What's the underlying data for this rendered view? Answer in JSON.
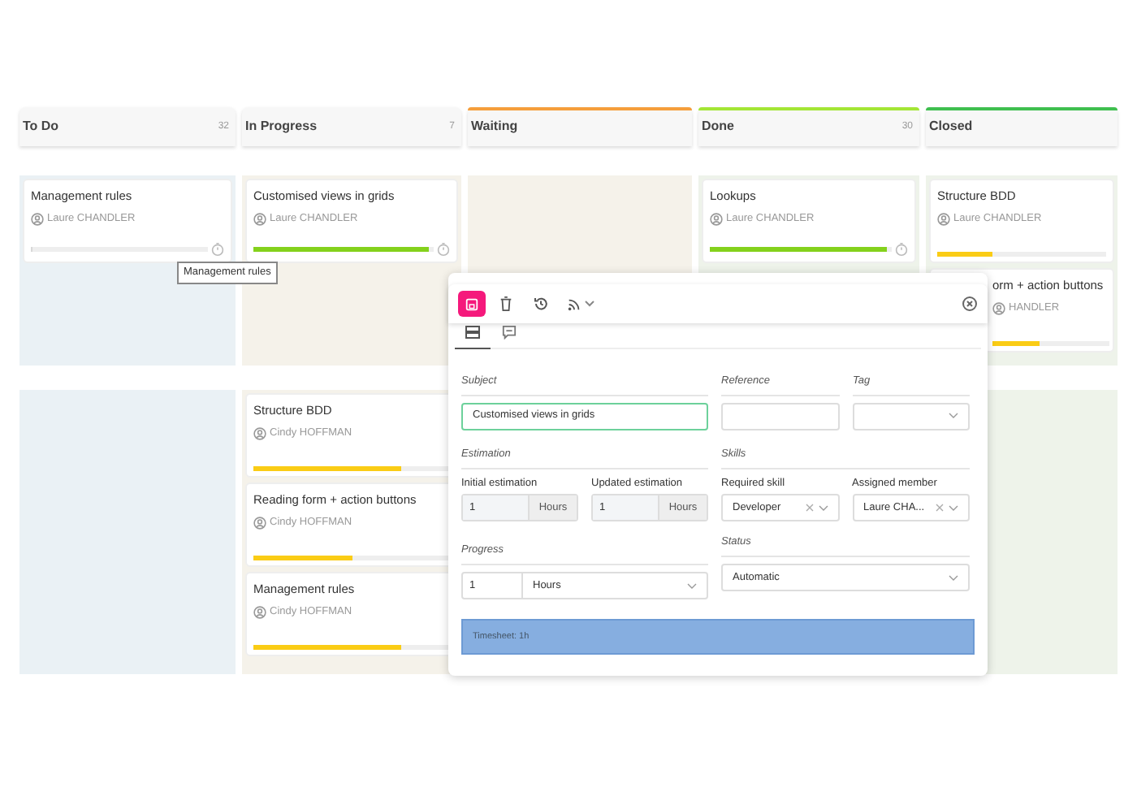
{
  "columns": [
    {
      "title": "To Do",
      "count": "32",
      "lane_1": [
        {
          "title": "Management rules",
          "assignee": "Laure CHANDLER",
          "level": 0,
          "timer": true,
          "clipped": false
        }
      ]
    },
    {
      "title": "In Progress",
      "count": "7",
      "lane_1": [
        {
          "title": "Customised views in grids",
          "assignee": "Laure CHANDLER",
          "level": 0.97,
          "color": "#84d11c",
          "timer": true,
          "clipped": false
        }
      ],
      "lane_2": [
        {
          "title": "Structure BDD",
          "assignee": "Cindy HOFFMAN",
          "level": 0.75,
          "color": "#facc15",
          "timer": false,
          "clipped": false
        },
        {
          "title": "Reading form + action buttons",
          "assignee": "Cindy HOFFMAN",
          "level": 0.5,
          "color": "#facc15",
          "timer": false,
          "clipped": false
        },
        {
          "title": "Management rules",
          "assignee": "Cindy HOFFMAN",
          "level": 0.75,
          "color": "#facc15",
          "timer": false,
          "clipped": false
        }
      ]
    },
    {
      "title": "Waiting",
      "color": "#f59e3b"
    },
    {
      "title": "Done",
      "count": "30",
      "color": "#a3e635",
      "lane_1": [
        {
          "title": "Lookups",
          "assignee": "Laure CHANDLER",
          "level": 0.97,
          "color": "#84d11c",
          "timer": true,
          "clipped": false
        }
      ]
    },
    {
      "title": "Closed",
      "color": "#3fbf4f",
      "lane_1": [
        {
          "title": "Structure BDD",
          "assignee": "Laure CHANDLER",
          "level": 0.33,
          "color": "#facc15",
          "timer": false,
          "clipped": false
        },
        {
          "title": "orm + action buttons",
          "assignee": "HANDLER",
          "level": 0.4,
          "color": "#facc15",
          "timer": false,
          "clipped": true
        }
      ]
    }
  ],
  "tooltip": {
    "text": "Management rules"
  },
  "dialog": {
    "toolbar": [
      {
        "kind": "save",
        "selected": true
      },
      {
        "kind": "delete",
        "selected": false
      },
      {
        "kind": "history",
        "selected": false
      },
      {
        "kind": "feed",
        "selected": false
      }
    ],
    "tabs": [
      {
        "kind": "form",
        "selected": true
      },
      {
        "kind": "comments",
        "selected": false
      }
    ],
    "subject": {
      "label": "Subject",
      "value": "Customised views in grids"
    },
    "reference": {
      "label": "Reference"
    },
    "tag": {
      "label": "Tag"
    },
    "estimation": {
      "label": "Estimation",
      "initial": {
        "label": "Initial estimation",
        "value": "1",
        "unit": "Hours"
      },
      "updated": {
        "label": "Updated estimation",
        "value": "1",
        "unit": "Hours"
      }
    },
    "skills": {
      "label": "Skills",
      "required": {
        "label": "Required skill",
        "value": "Developer"
      },
      "member": {
        "label": "Assigned member",
        "value": "Laure CHA..."
      }
    },
    "progress": {
      "label": "Progress",
      "value": "1",
      "unit": "Hours"
    },
    "status": {
      "label": "Status",
      "value": "Automatic"
    },
    "timesheet": "Timesheet: 1h"
  }
}
